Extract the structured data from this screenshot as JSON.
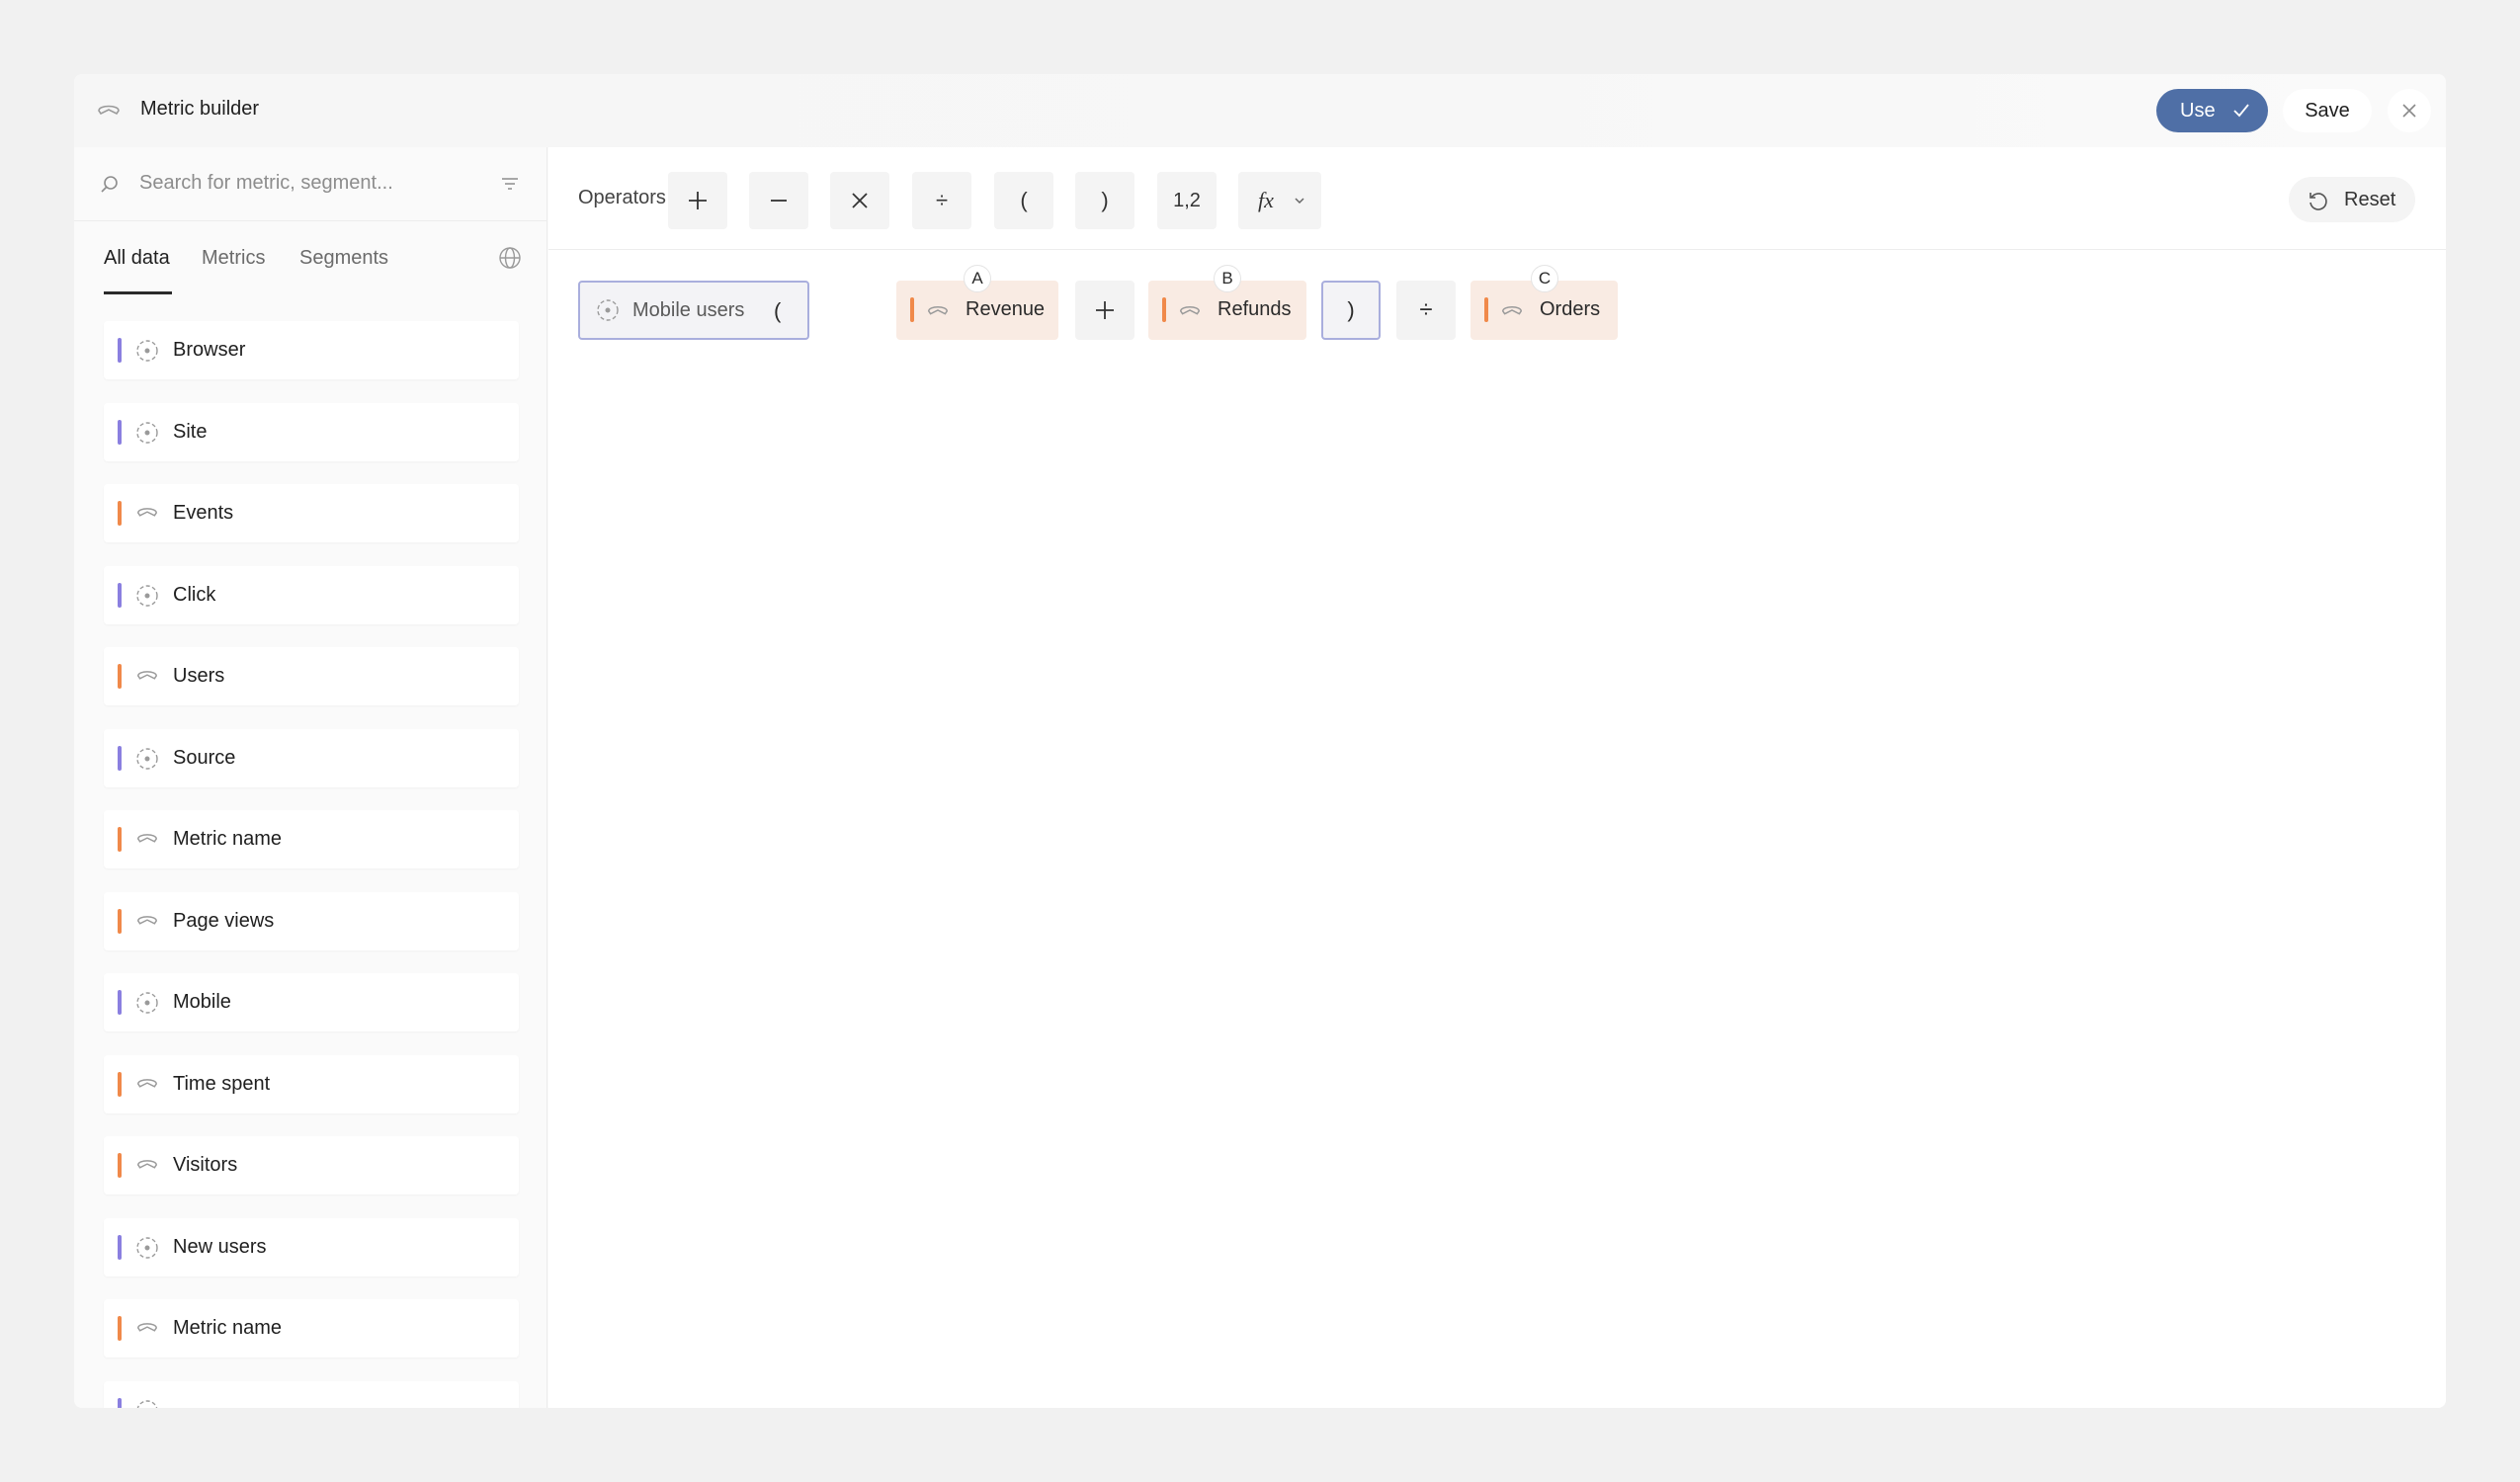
{
  "header": {
    "title": "Metric builder",
    "use_label": "Use",
    "save_label": "Save"
  },
  "search": {
    "placeholder": "Search for metric, segment..."
  },
  "tabs": [
    {
      "label": "All data",
      "active": true
    },
    {
      "label": "Metrics",
      "active": false
    },
    {
      "label": "Segments",
      "active": false
    }
  ],
  "items": [
    {
      "label": "Browser",
      "kind": "segment"
    },
    {
      "label": "Site",
      "kind": "segment"
    },
    {
      "label": "Events",
      "kind": "metric"
    },
    {
      "label": "Click",
      "kind": "segment"
    },
    {
      "label": "Users",
      "kind": "metric"
    },
    {
      "label": "Source",
      "kind": "segment"
    },
    {
      "label": "Metric name",
      "kind": "metric"
    },
    {
      "label": "Page views",
      "kind": "metric"
    },
    {
      "label": "Mobile",
      "kind": "segment"
    },
    {
      "label": "Time spent",
      "kind": "metric"
    },
    {
      "label": "Visitors",
      "kind": "metric"
    },
    {
      "label": "New users",
      "kind": "segment"
    },
    {
      "label": "Metric name",
      "kind": "metric"
    },
    {
      "label": "",
      "kind": "segment"
    }
  ],
  "operators": {
    "label": "Operators",
    "plus": "+",
    "minus": "−",
    "times": "×",
    "divide": "÷",
    "open_paren": "(",
    "close_paren": ")",
    "number": "1,2",
    "function": "fx"
  },
  "reset_label": "Reset",
  "formula": {
    "segment": "Mobile users",
    "open_paren": "(",
    "metric_a": {
      "label": "Revenue",
      "badge": "A"
    },
    "plus": "+",
    "metric_b": {
      "label": "Refunds",
      "badge": "B"
    },
    "close_paren": ")",
    "divide": "÷",
    "metric_c": {
      "label": "Orders",
      "badge": "C"
    }
  },
  "colors": {
    "accent": "#4f6fa6",
    "segment_bar": "#8a7fe0",
    "metric_bar": "#f0894a"
  }
}
